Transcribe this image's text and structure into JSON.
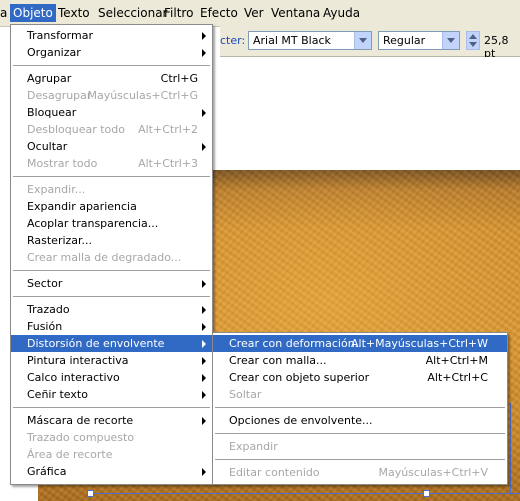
{
  "menubar": {
    "items": [
      {
        "label": "a"
      },
      {
        "label": "Objeto"
      },
      {
        "label": "Texto"
      },
      {
        "label": "Seleccionar"
      },
      {
        "label": "Filtro"
      },
      {
        "label": "Efecto"
      },
      {
        "label": "Ver"
      },
      {
        "label": "Ventana"
      },
      {
        "label": "Ayuda"
      }
    ]
  },
  "toolbar": {
    "character_label": "cter:",
    "font_family": "Arial MT Black",
    "font_style": "Regular",
    "font_size": "25,8 pt"
  },
  "object_menu": {
    "transformar": "Transformar",
    "organizar": "Organizar",
    "agrupar": "Agrupar",
    "agrupar_sc": "Ctrl+G",
    "desagrupar": "Desagrupar",
    "desagrupar_sc": "Mayúsculas+Ctrl+G",
    "bloquear": "Bloquear",
    "desbloquear": "Desbloquear todo",
    "desbloquear_sc": "Alt+Ctrl+2",
    "ocultar": "Ocultar",
    "mostrar": "Mostrar todo",
    "mostrar_sc": "Alt+Ctrl+3",
    "expandir": "Expandir...",
    "expandir_apariencia": "Expandir apariencia",
    "acoplar": "Acoplar transparencia...",
    "rasterizar": "Rasterizar...",
    "malla": "Crear malla de degradado...",
    "sector": "Sector",
    "trazado": "Trazado",
    "fusion": "Fusión",
    "distorsion": "Distorsión de envolvente",
    "pintura": "Pintura interactiva",
    "calco": "Calco interactivo",
    "cenir": "Ceñir texto",
    "mascara": "Máscara de recorte",
    "trazado_compuesto": "Trazado compuesto",
    "area_recorte": "Área de recorte",
    "grafica": "Gráfica"
  },
  "envelope_submenu": {
    "deformacion": "Crear con deformación...",
    "deformacion_sc": "Alt+Mayúsculas+Ctrl+W",
    "malla": "Crear con malla...",
    "malla_sc": "Alt+Ctrl+M",
    "objeto_superior": "Crear con objeto superior",
    "objeto_superior_sc": "Alt+Ctrl+C",
    "soltar": "Soltar",
    "opciones": "Opciones de envolvente...",
    "expandir": "Expandir",
    "editar": "Editar contenido",
    "editar_sc": "Mayúsculas+Ctrl+V"
  },
  "colors": {
    "highlight": "#316ac5",
    "menubar_bg": "#ece9d8",
    "disabled_text": "#a7a7a7"
  }
}
